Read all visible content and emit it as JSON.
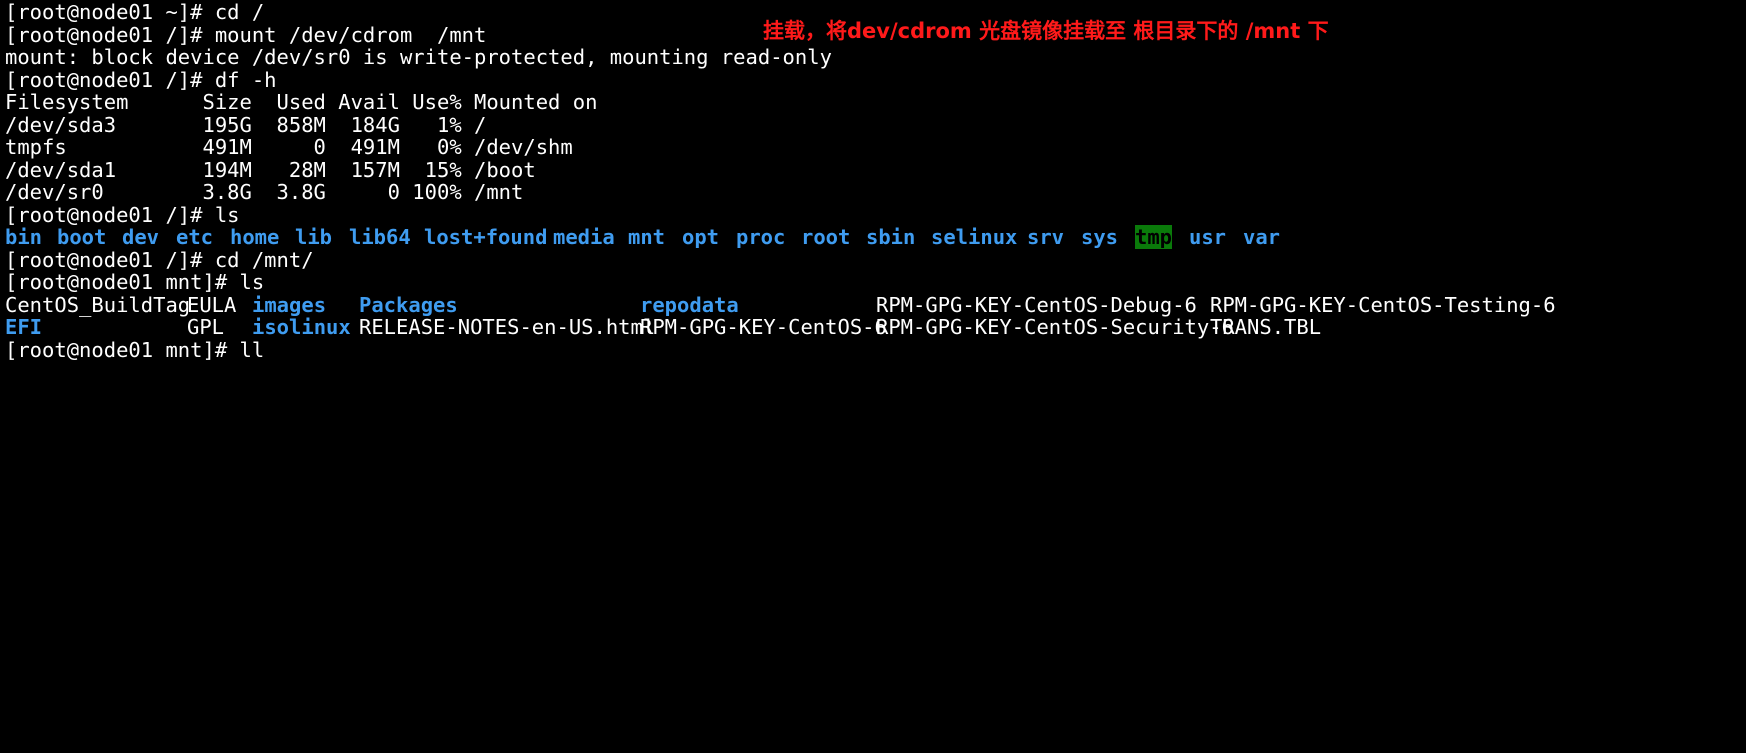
{
  "annotation": "挂载，将dev/cdrom 光盘镜像挂载至 根目录下的 /mnt 下",
  "lines": [
    "[root@node01 ~]# cd /",
    "[root@node01 /]# mount /dev/cdrom  /mnt",
    "mount: block device /dev/sr0 is write-protected, mounting read-only",
    "[root@node01 /]# df -h",
    "Filesystem      Size  Used Avail Use% Mounted on",
    "/dev/sda3       195G  858M  184G   1% /",
    "tmpfs           491M     0  491M   0% /dev/shm",
    "/dev/sda1       194M   28M  157M  15% /boot",
    "/dev/sr0        3.8G  3.8G     0 100% /mnt",
    "[root@node01 /]# ls"
  ],
  "ls_root": [
    "bin",
    "boot",
    "dev",
    "etc",
    "home",
    "lib",
    "lib64",
    "lost+found",
    "media",
    "mnt",
    "opt",
    "proc",
    "root",
    "sbin",
    "selinux",
    "srv",
    "sys",
    "tmp",
    "usr",
    "var"
  ],
  "cd_mnt": "[root@node01 /]# cd /mnt/",
  "ls_mnt_prompt": "[root@node01 mnt]# ls",
  "mnt_row1": [
    "CentOS_BuildTag",
    "EULA",
    "images",
    "Packages",
    "repodata",
    "RPM-GPG-KEY-CentOS-Debug-6",
    "RPM-GPG-KEY-CentOS-Testing-6"
  ],
  "mnt_row2": [
    "EFI",
    "GPL",
    "isolinux",
    "RELEASE-NOTES-en-US.html",
    "RPM-GPG-KEY-CentOS-6",
    "RPM-GPG-KEY-CentOS-Security-6",
    "TRANS.TBL"
  ],
  "last_prompt": "[root@node01 mnt]# ll"
}
